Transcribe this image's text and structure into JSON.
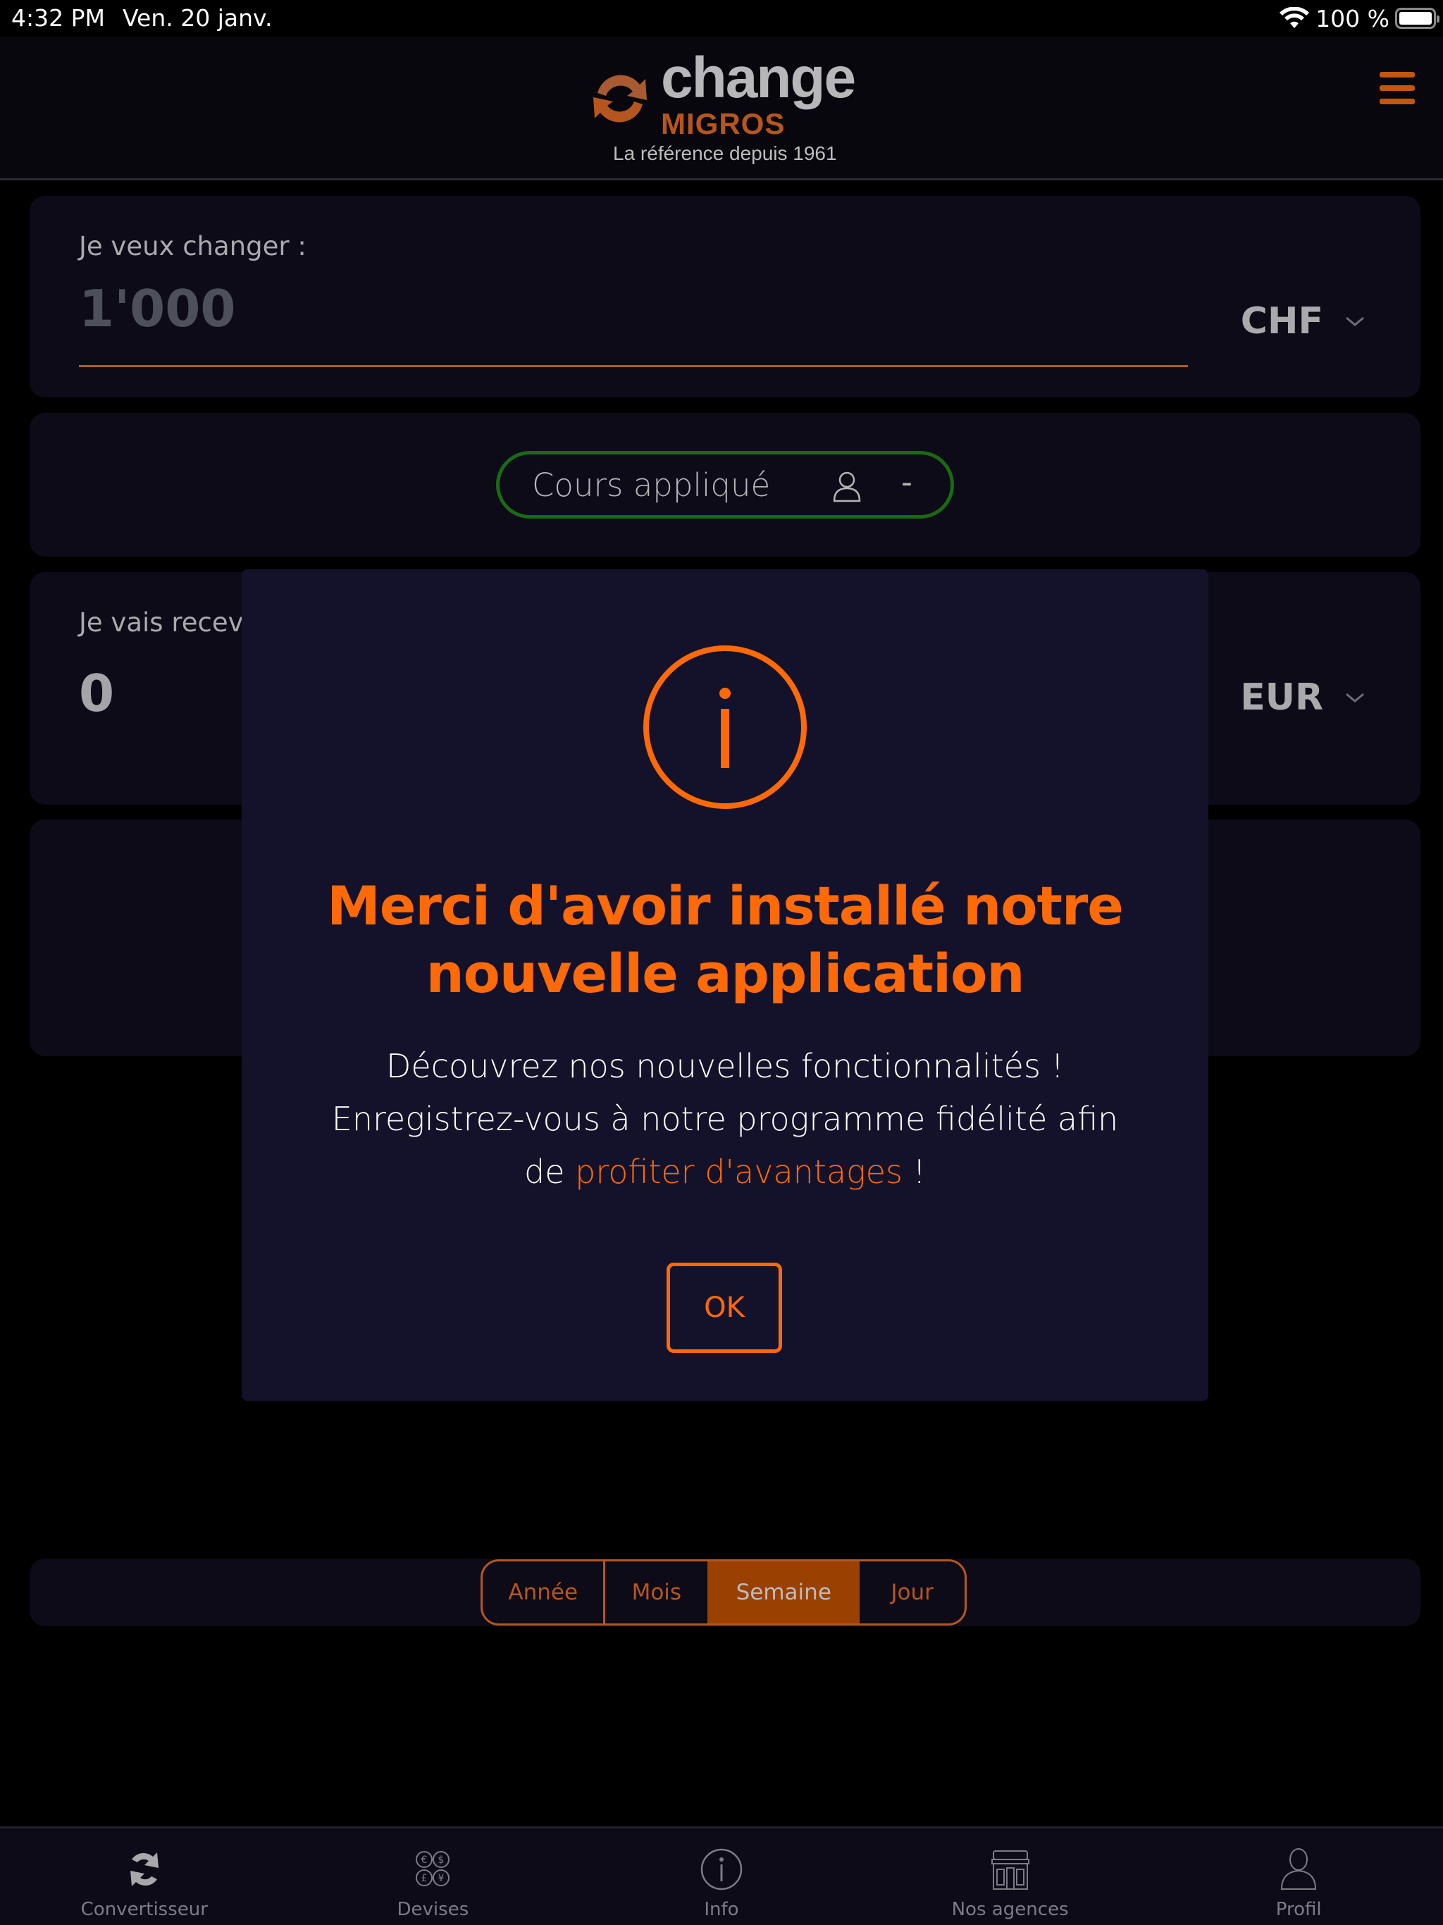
{
  "status_bar": {
    "time": "4:32 PM",
    "date": "Ven. 20 janv.",
    "wifi_icon": "wifi-icon",
    "battery_percent": "100 %",
    "battery_level": 1.0
  },
  "header": {
    "logo_word_top": "change",
    "logo_word_bottom": "MIGROS",
    "tagline": "La référence depuis 1961",
    "menu_icon": "hamburger-menu-icon"
  },
  "converter": {
    "from_label": "Je veux changer :",
    "from_amount": "1'000",
    "from_currency": "CHF",
    "rate_label": "Cours appliqué",
    "rate_value": "-",
    "to_label": "Je vais recevoir :",
    "to_amount": "0",
    "to_currency": "EUR"
  },
  "period": {
    "options": [
      "Année",
      "Mois",
      "Semaine",
      "Jour"
    ],
    "selected": "Semaine"
  },
  "modal": {
    "icon": "info-icon",
    "title": "Merci d'avoir installé notre nouvelle application",
    "body_line1": "Découvrez nos nouvelles fonctionnalités !",
    "body_line2": "Enregistrez-vous à notre programme fidélité afin",
    "body_line3_prefix": "de ",
    "body_link": "profiter d'avantages",
    "body_line3_suffix": " !",
    "ok_label": "OK"
  },
  "tabbar": {
    "items": [
      {
        "label": "Convertisseur",
        "icon": "converter-icon",
        "active": true
      },
      {
        "label": "Devises",
        "icon": "currencies-icon",
        "active": false
      },
      {
        "label": "Info",
        "icon": "info-icon",
        "active": false
      },
      {
        "label": "Nos agences",
        "icon": "store-icon",
        "active": false
      },
      {
        "label": "Profil",
        "icon": "profile-icon",
        "active": false
      }
    ]
  },
  "colors": {
    "accent": "#ff6a08",
    "brand_orange": "#b6561f",
    "rate_border_green": "#1a6a14",
    "panel_bg": "#0c0b17",
    "modal_bg": "#14122a"
  }
}
